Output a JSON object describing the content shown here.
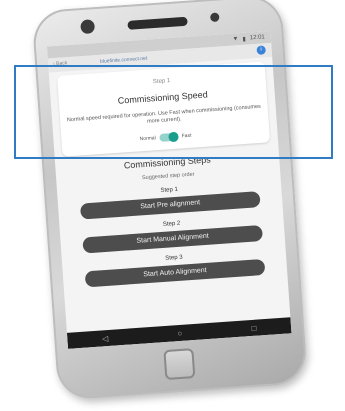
{
  "status_bar": {
    "time": "12:01"
  },
  "app_bar": {
    "back_label": "Back",
    "url": "bluefinite.connect.net"
  },
  "speed_card": {
    "step": "Step 1",
    "title": "Commissioning Speed",
    "description": "Normal speed required for operation. Use Fast when commissioning (consumes more current).",
    "toggle_off_label": "Normal",
    "toggle_on_label": "Fast",
    "toggle_state": "Fast"
  },
  "commissioning_steps": {
    "title": "Commissioning Steps",
    "subtitle": "Suggested step order",
    "steps": [
      {
        "label": "Step 1",
        "button": "Start Pre alignment"
      },
      {
        "label": "Step 2",
        "button": "Start Manual Alignment"
      },
      {
        "label": "Step 3",
        "button": "Start Auto Alignment"
      }
    ]
  },
  "colors": {
    "highlight": "#2f7cc4",
    "toggle": "#1c9e8f",
    "button": "#4d4d4d"
  },
  "icons": [
    "back-icon",
    "info-icon",
    "nav-back-icon",
    "nav-home-icon",
    "nav-recent-icon"
  ]
}
